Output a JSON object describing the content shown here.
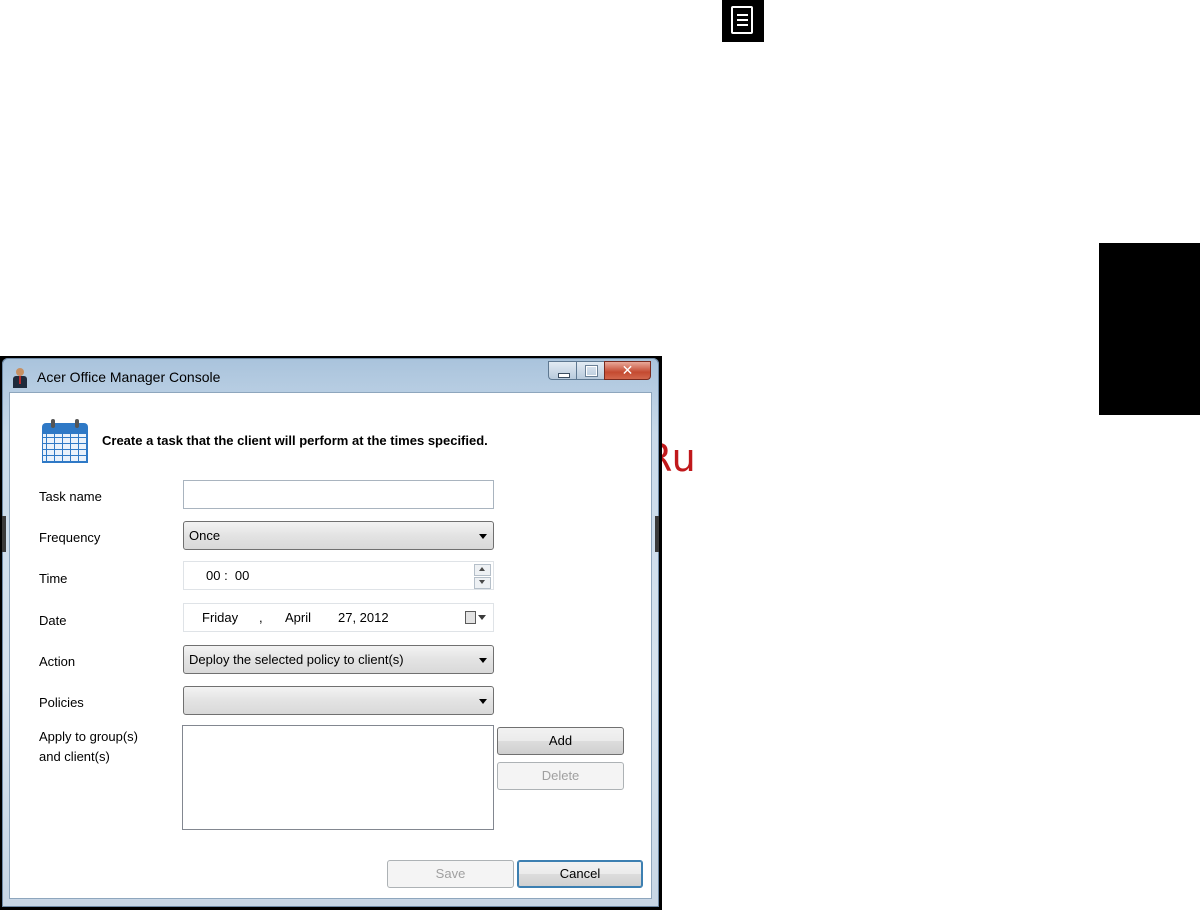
{
  "page": {
    "watermark": "McGrp.Ru"
  },
  "window": {
    "title": "Acer Office Manager Console",
    "controls": {
      "close_glyph": "✕"
    }
  },
  "dialog": {
    "heading": "Create a task that the client will perform at the times specified.",
    "task_name": {
      "label": "Task name",
      "value": ""
    },
    "frequency": {
      "label": "Frequency",
      "value": "Once"
    },
    "time": {
      "label": "Time",
      "value": "00 :  00"
    },
    "date": {
      "label": "Date",
      "weekday": "Friday",
      "comma": ",",
      "month": "April",
      "day_year": "27, 2012"
    },
    "action": {
      "label": "Action",
      "value": "Deploy the selected policy to client(s)"
    },
    "policies": {
      "label": "Policies",
      "value": ""
    },
    "apply": {
      "label_line1": "Apply to group(s)",
      "label_line2": "and client(s)"
    },
    "buttons": {
      "add": "Add",
      "delete": "Delete",
      "save": "Save",
      "cancel": "Cancel"
    }
  },
  "icons": {
    "top_right": "document-icon",
    "app": "person-icon",
    "dialog": "calendar-icon"
  },
  "colors": {
    "watermark": "#c0181b",
    "titlebar": "#c9daea",
    "close_button": "#c44a31",
    "calendar": "#2f79c6"
  }
}
